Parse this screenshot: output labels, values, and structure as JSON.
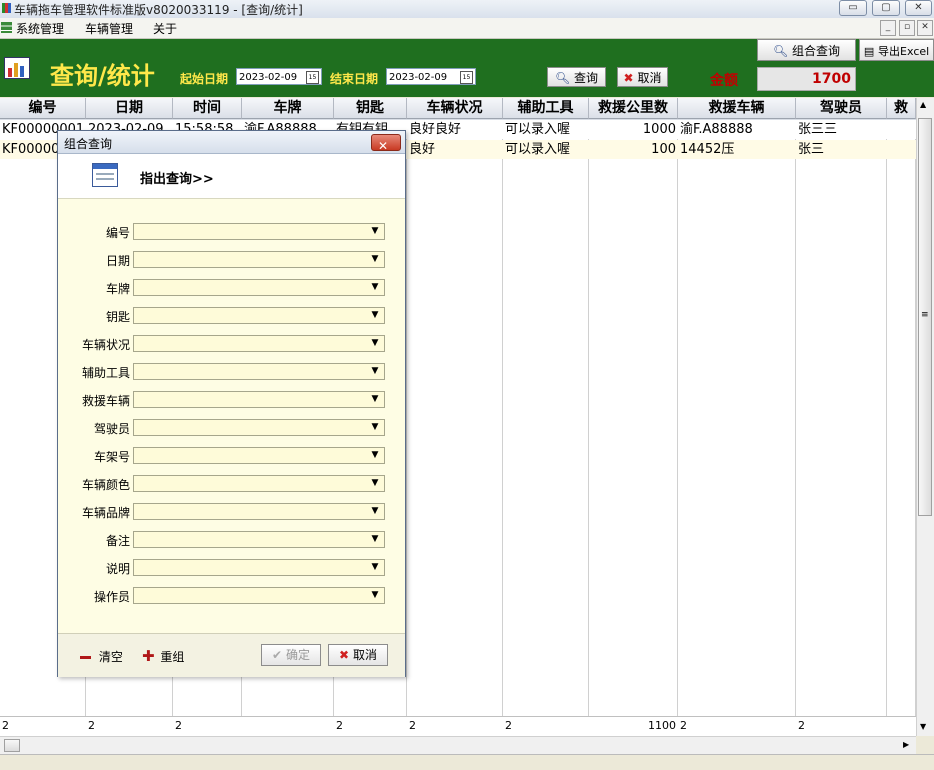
{
  "window": {
    "title": "车辆拖车管理软件标准版v8020033119 - [查询/统计]",
    "minimize_glyph": "▭",
    "maximize_glyph": "▢",
    "close_glyph": "✕"
  },
  "menu": {
    "items": [
      "系统管理",
      "车辆管理",
      "关于"
    ],
    "mdi_min": "_",
    "mdi_restore": "▫",
    "mdi_close": "✕"
  },
  "header": {
    "title": "查询/统计",
    "start_label": "起始日期",
    "start_value": "2023-02-09",
    "end_label": "结束日期",
    "end_value": "2023-02-09",
    "calendar_glyph": "15",
    "query_button": "查询",
    "cancel_button": "取消",
    "combo_query_button": "组合查询",
    "export_button": "导出Excel",
    "total_label": "金额",
    "total_value": "1700"
  },
  "table": {
    "columns": [
      "编号",
      "日期",
      "时间",
      "车牌",
      "钥匙",
      "车辆状况",
      "辅助工具",
      "救援公里数",
      "救援车辆",
      "驾驶员",
      "救"
    ],
    "rows": [
      [
        "KF00000001",
        "2023-02-09",
        "15:58:58",
        "渝F.A88888",
        "有钥有钥",
        "良好良好",
        "可以录入喔",
        "1000",
        "渝F.A88888",
        "张三三"
      ],
      [
        "KF00000",
        "",
        "",
        "",
        "",
        "良好",
        "可以录入喔",
        "100",
        "14452压",
        "张三"
      ]
    ],
    "footer": [
      "2",
      "2",
      "2",
      "",
      "2",
      "2",
      "2",
      "1100",
      "2",
      "2"
    ]
  },
  "dialog": {
    "title": "组合查询",
    "hint": "指出查询>>",
    "fields": [
      "编号",
      "日期",
      "车牌",
      "钥匙",
      "车辆状况",
      "辅助工具",
      "救援车辆",
      "驾驶员",
      "车架号",
      "车辆颜色",
      "车辆品牌",
      "备注",
      "说明",
      "操作员"
    ],
    "clear_label": "清空",
    "regroup_label": "重组",
    "ok_label": "确定",
    "cancel_label": "取消"
  },
  "colors": {
    "header_bg": "#1f6f1f",
    "header_text": "#ffe84a",
    "total_text": "#c00000",
    "dialog_bg": "#fefde4",
    "row_alt": "#fffbe6"
  }
}
